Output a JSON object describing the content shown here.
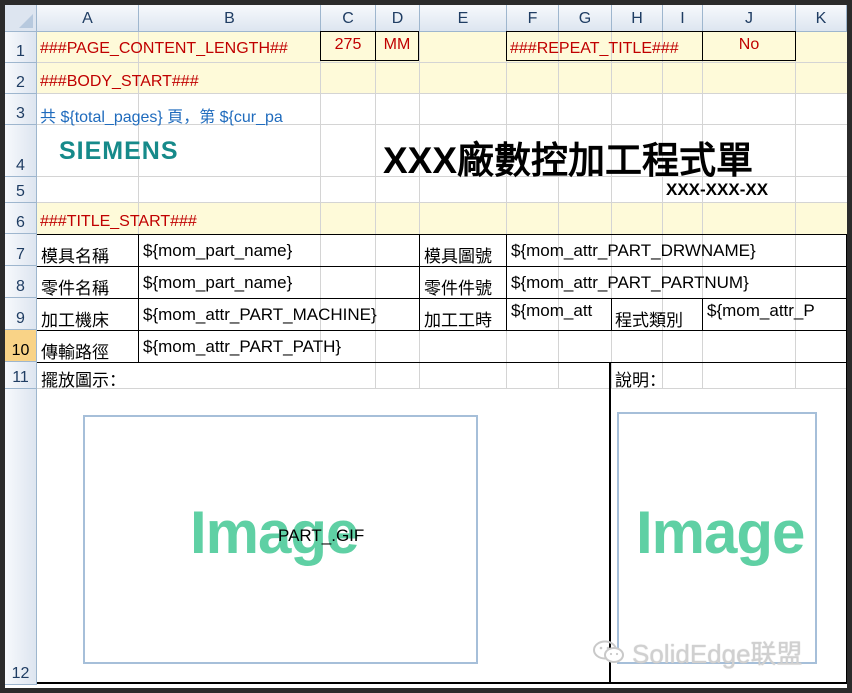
{
  "columns": [
    "A",
    "B",
    "C",
    "D",
    "E",
    "F",
    "G",
    "H",
    "I",
    "J",
    "K"
  ],
  "rows": [
    "1",
    "2",
    "3",
    "4",
    "5",
    "6",
    "7",
    "8",
    "9",
    "10",
    "11",
    "12"
  ],
  "row1": {
    "page_content_length": "###PAGE_CONTENT_LENGTH##",
    "length_value": "275",
    "length_unit": "MM",
    "repeat_title": "###REPEAT_TITLE###",
    "repeat_value": "No"
  },
  "row2": {
    "body_start": "###BODY_START###"
  },
  "row3": {
    "page_info": "共  ${total_pages}  頁，第  ${cur_pa"
  },
  "header": {
    "logo": "SIEMENS",
    "title": "XXX廠數控加工程式單",
    "doc_number": "XXX-XXX-XX"
  },
  "row6": {
    "title_start": "###TITLE_START###"
  },
  "form": {
    "row7": {
      "label1": "模具名稱",
      "value1": "${mom_part_name}",
      "label2": "模具圖號",
      "value2": "${mom_attr_PART_DRWNAME}"
    },
    "row8": {
      "label1": "零件名稱",
      "value1": "${mom_part_name}",
      "label2": "零件件號",
      "value2": "${mom_attr_PART_PARTNUM}"
    },
    "row9": {
      "label1": "加工機床",
      "value1": "${mom_attr_PART_MACHINE}",
      "label2": "加工工時",
      "value2": "${mom_att",
      "label3": "程式類別",
      "value3": "${mom_attr_P"
    },
    "row10": {
      "label1": "傳輸路徑",
      "value1": "${mom_attr_PART_PATH}"
    }
  },
  "row11": {
    "placement_label": "擺放圖示：",
    "notes_label": "說明："
  },
  "images": {
    "left_placeholder": "Image",
    "left_caption": "PART_.GIF",
    "right_placeholder": "Image"
  },
  "watermark": "SolidEdge联盟"
}
